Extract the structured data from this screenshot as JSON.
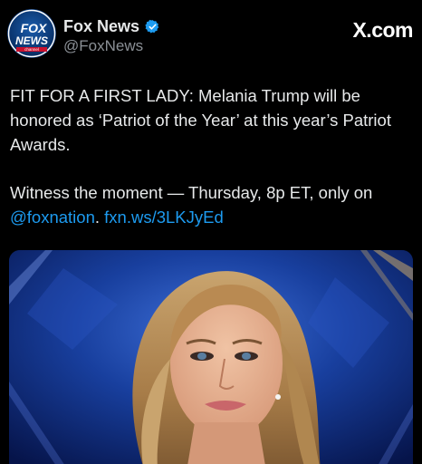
{
  "account": {
    "display_name": "Fox News",
    "handle": "@FoxNews",
    "verified_icon": "verified-badge-icon",
    "avatar_text": {
      "line1": "FOX",
      "line2": "NEWS",
      "line3": "channel"
    }
  },
  "site_label": "X.com",
  "post": {
    "paragraph1": "FIT FOR A FIRST LADY: Melania Trump will be honored as ‘Patriot of the Year’ at this year’s Patriot Awards.",
    "paragraph2_text": "Witness the moment — Thursday, 8p ET, only on ",
    "mention": "@foxnation",
    "separator": ". ",
    "url": "fxn.ws/3LKJyEd"
  },
  "media": {
    "type": "photo"
  },
  "colors": {
    "background": "#000000",
    "text": "#e7e9ea",
    "secondary_text": "#8b9096",
    "link": "#1d9bf0",
    "verified": "#1d9bf0"
  }
}
